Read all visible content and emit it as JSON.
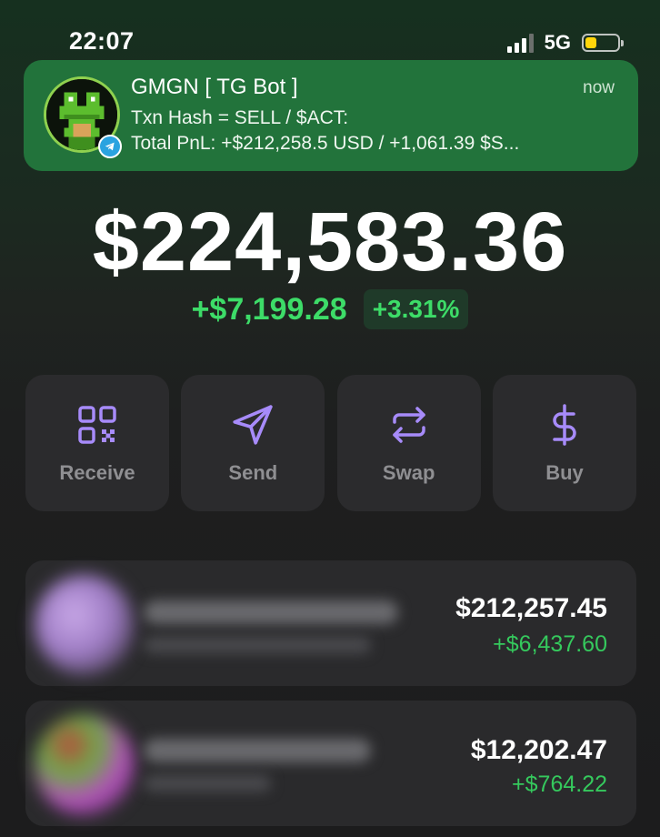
{
  "status_bar": {
    "time": "22:07",
    "network": "5G",
    "battery_level": 0.35,
    "battery_color": "#ffd60a"
  },
  "notification": {
    "app": "GMGN [ TG Bot ]",
    "time": "now",
    "line1": "Txn Hash = SELL / $ACT:",
    "line2": "Total PnL: +$212,258.5 USD / +1,061.39 $S...",
    "badge_icon": "telegram-icon",
    "background": "#22733b"
  },
  "balance": {
    "total": "$224,583.36",
    "change_amount": "+$7,199.28",
    "change_percent": "+3.31%",
    "positive_color": "#3ddc68"
  },
  "actions": [
    {
      "label": "Receive",
      "icon": "qr-code-icon"
    },
    {
      "label": "Send",
      "icon": "send-icon"
    },
    {
      "label": "Swap",
      "icon": "swap-icon"
    },
    {
      "label": "Buy",
      "icon": "dollar-icon"
    }
  ],
  "accent_color": "#a78bfa",
  "assets": [
    {
      "value": "$212,257.45",
      "change": "+$6,437.60"
    },
    {
      "value": "$12,202.47",
      "change": "+$764.22"
    }
  ]
}
